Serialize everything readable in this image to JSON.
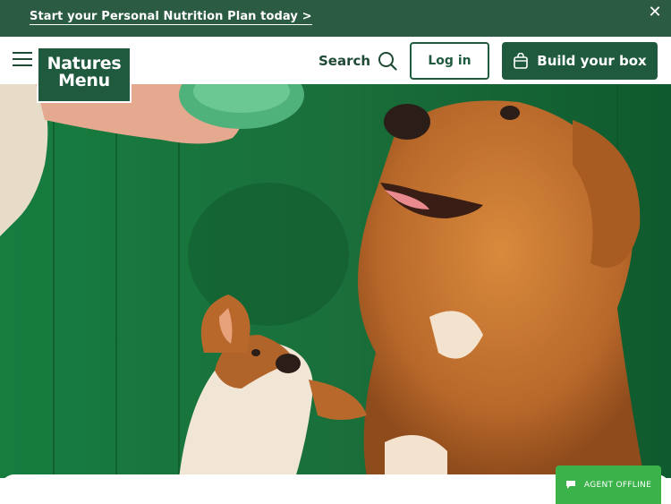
{
  "promo": {
    "link_text": "Start your Personal Nutrition Plan today >",
    "close_glyph": "✕"
  },
  "header": {
    "logo_line1": "Natures",
    "logo_line2": "Menu",
    "search_label": "Search",
    "login_label": "Log in",
    "build_label": "Build your box"
  },
  "hero": {
    "image_alt": "Two dogs sitting in front of a green wall"
  },
  "chat": {
    "status_label": "AGENT OFFLINE"
  },
  "colors": {
    "brand_green": "#1f5a3e",
    "promo_bar": "#2c5b43",
    "chat_green": "#3bb24a"
  },
  "icons": [
    "menu-icon",
    "close-icon",
    "search-icon",
    "bag-icon",
    "chat-icon"
  ]
}
